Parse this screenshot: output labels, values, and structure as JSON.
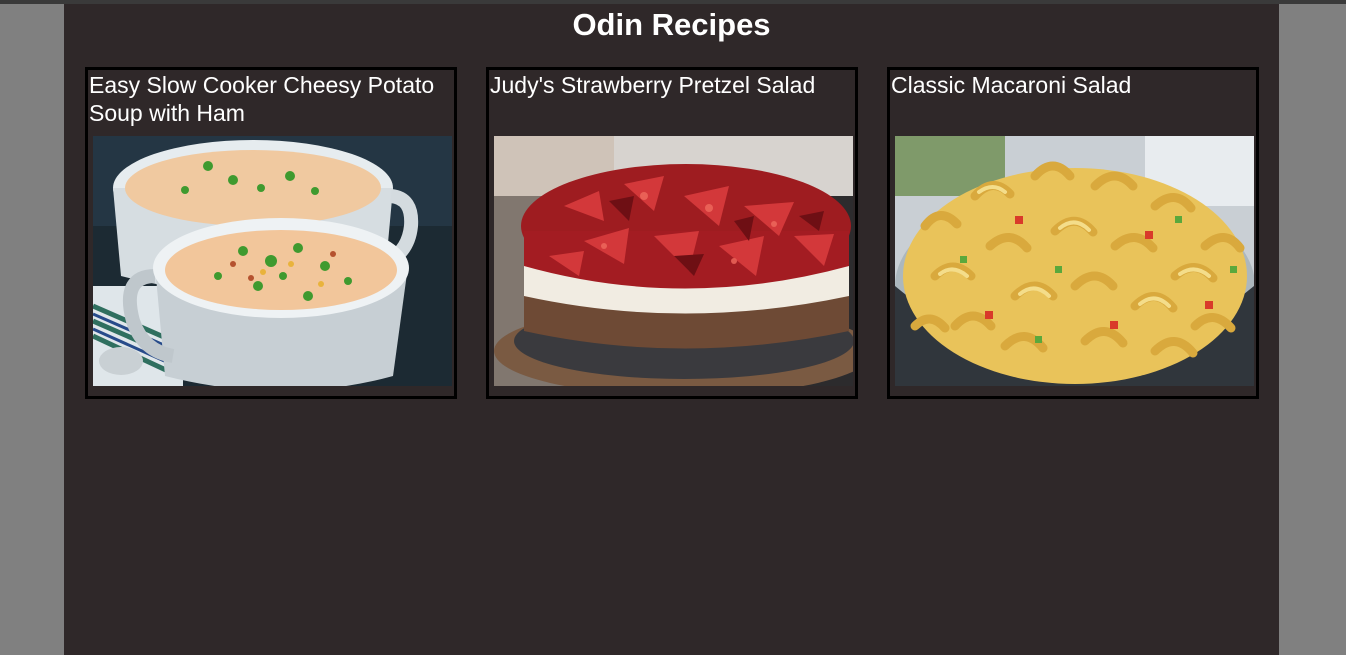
{
  "page": {
    "title": "Odin Recipes"
  },
  "recipes": [
    {
      "name": "Easy Slow Cooker Cheesy Potato Soup with Ham",
      "image": "potato-soup-photo"
    },
    {
      "name": "Judy's Strawberry Pretzel Salad",
      "image": "strawberry-pretzel-salad-photo"
    },
    {
      "name": "Classic Macaroni Salad",
      "image": "macaroni-salad-photo"
    }
  ]
}
